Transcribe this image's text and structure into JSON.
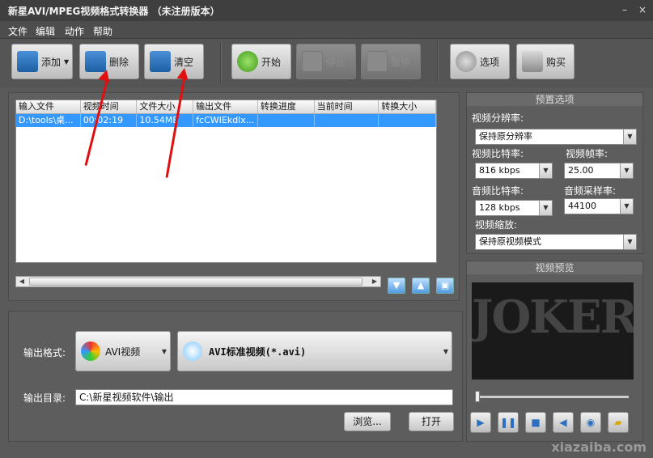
{
  "window": {
    "title": "新星AVI/MPEG视频格式转换器 （未注册版本）",
    "minimize": "–",
    "close": "×"
  },
  "menu": [
    "文件",
    "编辑",
    "动作",
    "帮助"
  ],
  "toolbar": {
    "add": "添加",
    "remove": "删除",
    "clear": "清空",
    "start": "开始",
    "stop": "停止",
    "pause": "暂停",
    "options": "选项",
    "buy": "购买"
  },
  "table": {
    "headers": [
      "输入文件",
      "视频时间",
      "文件大小",
      "输出文件",
      "转换进度",
      "当前时间",
      "转换大小"
    ],
    "rows": [
      [
        "D:\\tools\\桌...",
        "00:02:19",
        "10.54MB",
        "fcCWIEkdlx...",
        "",
        "",
        ""
      ]
    ]
  },
  "output": {
    "format_label": "输出格式:",
    "format_value": "AVI视频",
    "profile_value": "AVI标准视频(*.avi)",
    "dir_label": "输出目录:",
    "dir_value": "C:\\新星视频软件\\输出",
    "browse": "浏览...",
    "open": "打开"
  },
  "preset": {
    "title": "预置选项",
    "resolution_label": "视频分辨率:",
    "resolution_value": "保持原分辨率",
    "vbitrate_label": "视频比特率:",
    "vbitrate_value": "816 kbps",
    "framerate_label": "视频帧率:",
    "framerate_value": "25.00",
    "abitrate_label": "音频比特率:",
    "abitrate_value": "128 kbps",
    "samplerate_label": "音频采样率:",
    "samplerate_value": "44100",
    "scale_label": "视频缩放:",
    "scale_value": "保持原视频模式"
  },
  "preview": {
    "title": "视频预览",
    "poster_text": "JOKER"
  },
  "watermark": "xiazaiba.com",
  "colors": {
    "selection": "#3399ff",
    "annotation_arrow": "#e01010"
  }
}
